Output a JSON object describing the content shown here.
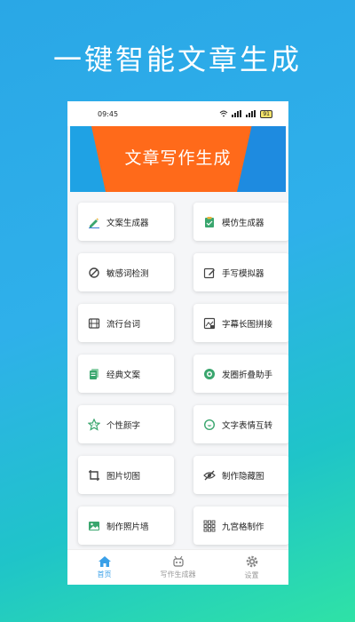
{
  "headline": "一键智能文章生成",
  "status": {
    "time": "09:45",
    "signal_text": "᯾ 🔋",
    "battery": "91"
  },
  "banner": {
    "title": "文章写作生成"
  },
  "cards": [
    {
      "label": "文案生成器",
      "icon": "pencil-icon"
    },
    {
      "label": "模仿生成器",
      "icon": "clipboard-check-icon"
    },
    {
      "label": "敏感词检测",
      "icon": "block-icon"
    },
    {
      "label": "手写模拟器",
      "icon": "edit-square-icon"
    },
    {
      "label": "流行台词",
      "icon": "film-icon"
    },
    {
      "label": "字幕长图拼接",
      "icon": "image-text-icon"
    },
    {
      "label": "经典文案",
      "icon": "document-icon"
    },
    {
      "label": "发圈折叠助手",
      "icon": "circle-dot-icon"
    },
    {
      "label": "个性颜字",
      "icon": "star-face-icon"
    },
    {
      "label": "文字表情互转",
      "icon": "smile-icon"
    },
    {
      "label": "图片切图",
      "icon": "crop-icon"
    },
    {
      "label": "制作隐藏图",
      "icon": "eye-off-icon"
    },
    {
      "label": "制作照片墙",
      "icon": "photo-icon"
    },
    {
      "label": "九宫格制作",
      "icon": "grid-icon"
    }
  ],
  "tabs": [
    {
      "label": "首页",
      "icon": "home-icon",
      "active": true
    },
    {
      "label": "写作生成器",
      "icon": "robot-icon",
      "active": false
    },
    {
      "label": "设置",
      "icon": "gear-icon",
      "active": false
    }
  ],
  "colors": {
    "accent": "#3aa0e8",
    "banner_orange": "#ff6a1a",
    "icon_green": "#3aa66e"
  }
}
